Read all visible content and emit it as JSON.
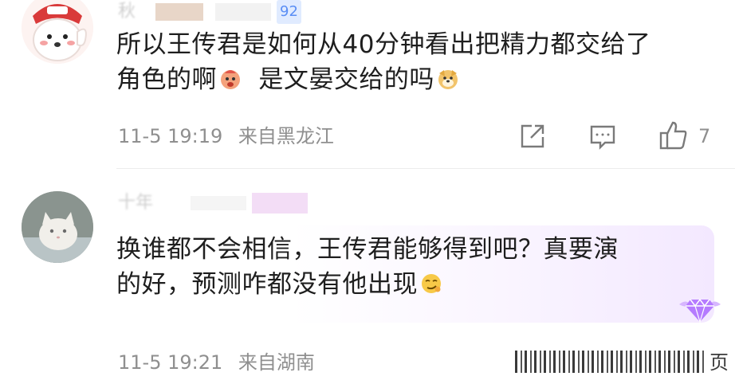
{
  "comments": [
    {
      "username": "秋",
      "username_badge": "92",
      "text_line1": "所以王传君是如何从40分钟看出把精力都交给了",
      "text_line2_a": "角色的啊",
      "text_line2_b": "是文晏交给的吗",
      "date": "11-5 19:19",
      "location": "来自黑龙江",
      "like_count": "7"
    },
    {
      "username": "十年",
      "text_line1": "换谁都不会相信，王传君能够得到吧？真要演",
      "text_line2": "的好，预测咋都没有他出现",
      "date": "11-5 19:21",
      "location": "来自湖南",
      "trailing_char": "页"
    }
  ],
  "colors": {
    "text": "#1e1e1e",
    "meta": "#8f8f8f",
    "accent_purple": "#b57bff"
  },
  "icons": [
    "share-icon",
    "comment-icon",
    "like-icon"
  ]
}
